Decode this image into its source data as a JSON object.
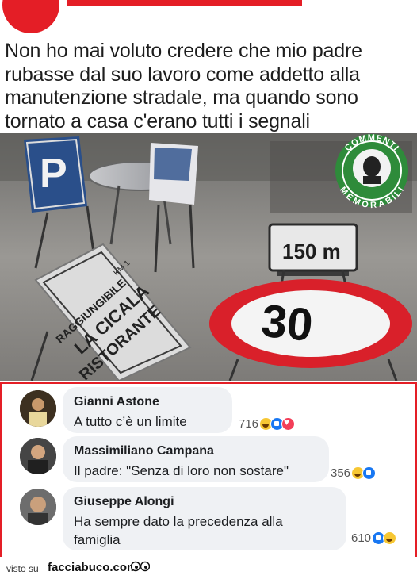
{
  "meme": {
    "caption": "Non ho mai voluto credere che mio padre rubasse dal suo lavoro come addetto alla manutenzione stradale, ma quando sono tornato a casa c'erano tutti i segnali",
    "sign_p": "P",
    "sign_150": "150 m",
    "sign_30": "30",
    "sign_ristorante": "RISTORANTE",
    "sign_la_cica": "LA CICALA",
    "sign_raggiungibile": "RAGGIUNGIBILE",
    "sign_km": "KM 1",
    "badge_top": "COMMENTI",
    "badge_bottom": "MEMORABILI"
  },
  "comments": [
    {
      "author": "Gianni Astone",
      "text": "A tutto c’è un limite",
      "count": "716"
    },
    {
      "author": "Massimiliano Campana",
      "text": "Il padre: \"Senza di loro non sostare\"",
      "count": "356"
    },
    {
      "author": "Giuseppe Alongi",
      "text": "Ha sempre dato la precedenza alla famiglia",
      "count": "610"
    }
  ],
  "footer": {
    "visto": "visto su",
    "brand": "facciabuco.com"
  },
  "colors": {
    "accent_red": "#e41e26",
    "bubble_bg": "#eff1f4",
    "badge_green": "#2e8b3a"
  }
}
